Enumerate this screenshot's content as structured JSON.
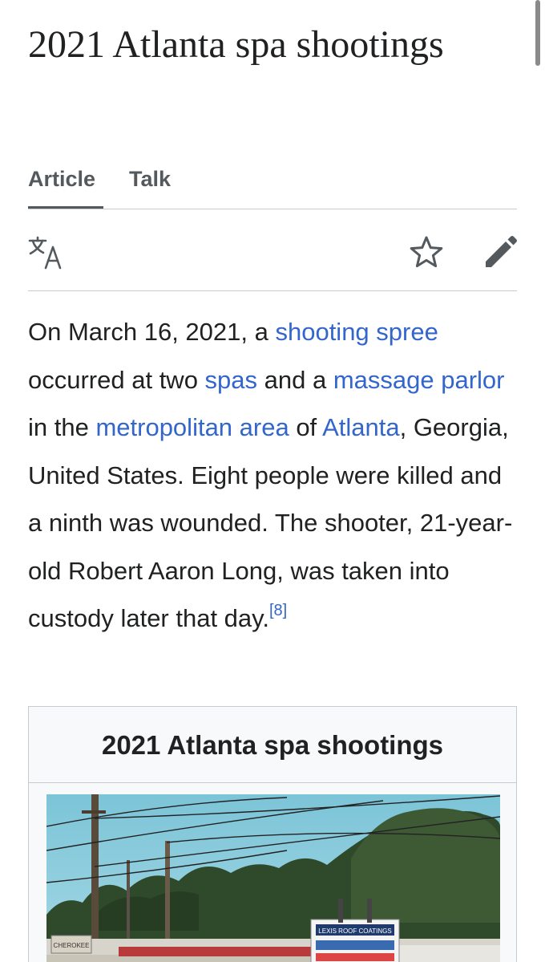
{
  "article": {
    "title": "2021 Atlanta spa shootings"
  },
  "tabs": {
    "article": "Article",
    "talk": "Talk"
  },
  "toolbar": {
    "icons": [
      "translate-icon",
      "star-icon",
      "edit-icon"
    ]
  },
  "lead": {
    "t1": "On March 16, 2021, a ",
    "link_shooting_spree": "shooting spree",
    "t2": " occurred at two ",
    "link_spas": "spas",
    "t3": " and a ",
    "link_massage_parlor": "massage parlor",
    "t4": " in the ",
    "link_metropolitan_area": "metropolitan area",
    "t5": " of ",
    "link_atlanta": "Atlanta",
    "t6": ", Georgia, United States. Eight people were killed and a ninth was wounded. The shooter, 21-year-old Robert Aaron Long, was taken into custody later that day.",
    "ref": "[8]"
  },
  "infobox": {
    "title": "2021 Atlanta spa shootings",
    "sign_top": "LEXIS ROOF COATINGS",
    "sign_left": "CHEROKEE"
  },
  "colors": {
    "link": "#3366cc",
    "text": "#202122",
    "icon": "#54595d",
    "border": "#c8ccd1",
    "infobox_bg": "#f8f9fa"
  }
}
